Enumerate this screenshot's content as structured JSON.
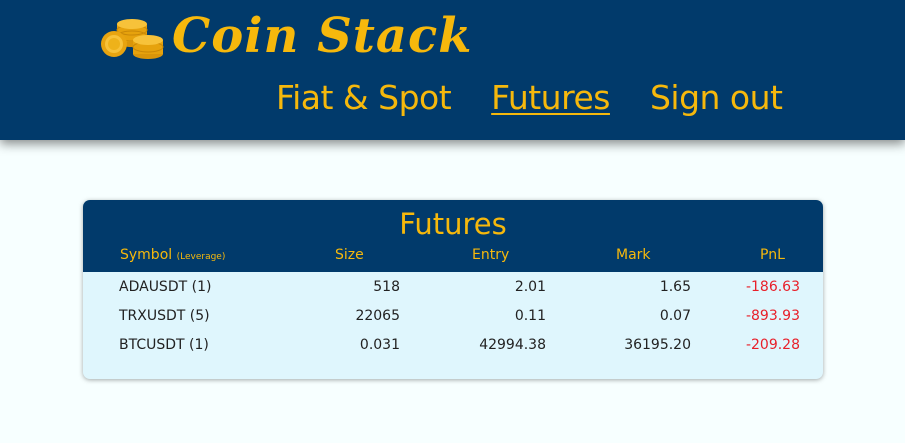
{
  "brand": {
    "name": "Coin Stack",
    "colors": {
      "header_bg": "#013a6b",
      "accent": "#f6b80c",
      "loss": "#e8202a",
      "panel_bg": "#dff6fd"
    },
    "icon": "coin-stack-icon"
  },
  "nav": {
    "items": [
      {
        "label": "Fiat & Spot",
        "active": false
      },
      {
        "label": "Futures",
        "active": true
      },
      {
        "label": "Sign out",
        "active": false
      }
    ]
  },
  "futures": {
    "title": "Futures",
    "columns": {
      "symbol": "Symbol",
      "leverage": "(Leverage)",
      "size": "Size",
      "entry": "Entry",
      "mark": "Mark",
      "pnl": "PnL"
    },
    "rows": [
      {
        "symbol": "ADAUSDT (1)",
        "size": "518",
        "entry": "2.01",
        "mark": "1.65",
        "pnl": "-186.63"
      },
      {
        "symbol": "TRXUSDT (5)",
        "size": "22065",
        "entry": "0.11",
        "mark": "0.07",
        "pnl": "-893.93"
      },
      {
        "symbol": "BTCUSDT (1)",
        "size": "0.031",
        "entry": "42994.38",
        "mark": "36195.20",
        "pnl": "-209.28"
      }
    ]
  }
}
